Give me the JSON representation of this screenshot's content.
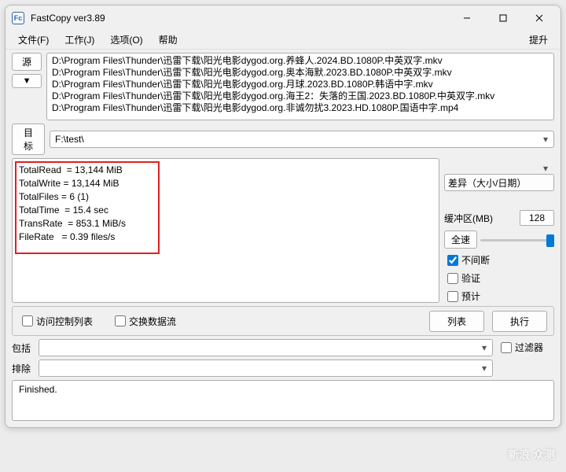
{
  "window": {
    "title": "FastCopy ver3.89"
  },
  "menu": {
    "file": "文件(F)",
    "job": "工作(J)",
    "options": "选项(O)",
    "help": "帮助",
    "boost": "提升"
  },
  "buttons": {
    "source": "源",
    "more": "▼",
    "dest": "目标",
    "fullspeed": "全速",
    "list": "列表",
    "execute": "执行"
  },
  "source_files": [
    "D:\\Program Files\\Thunder\\迅雷下载\\阳光电影dygod.org.养蜂人.2024.BD.1080P.中英双字.mkv",
    "D:\\Program Files\\Thunder\\迅雷下载\\阳光电影dygod.org.奥本海默.2023.BD.1080P.中英双字.mkv",
    "D:\\Program Files\\Thunder\\迅雷下载\\阳光电影dygod.org.月球.2023.BD.1080P.韩语中字.mkv",
    "D:\\Program Files\\Thunder\\迅雷下载\\阳光电影dygod.org.海王2：失落的王国.2023.BD.1080P.中英双字.mkv",
    "D:\\Program Files\\Thunder\\迅雷下载\\阳光电影dygod.org.非诚勿扰3.2023.HD.1080P.国语中字.mp4"
  ],
  "dest": "F:\\test\\",
  "stats": {
    "TotalRead": "13,144 MiB",
    "TotalWrite": "13,144 MiB",
    "TotalFiles": "6 (1)",
    "TotalTime": "15.4 sec",
    "TransRate": "853.1 MiB/s",
    "FileRate": "0.39 files/s"
  },
  "right": {
    "mode": "差异（大小/日期）",
    "buffer_label": "缓冲区(MB)",
    "buffer_value": "128",
    "nonstop": "不间断",
    "verify": "验证",
    "estimate": "预计"
  },
  "opts": {
    "acl": "访问控制列表",
    "altstream": "交换数据流"
  },
  "filter": {
    "include": "包括",
    "exclude": "排除",
    "filter_label": "过滤器"
  },
  "status": "Finished.",
  "watermark": "新浪\n众测"
}
